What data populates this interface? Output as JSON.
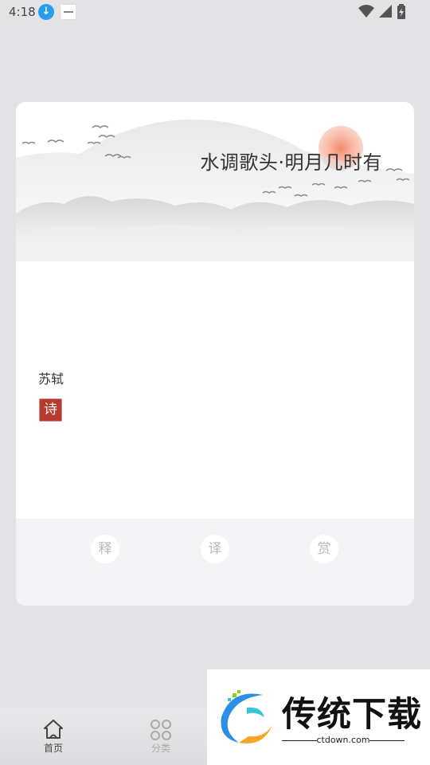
{
  "status_bar": {
    "time": "4:18",
    "download_icon": "download-icon",
    "app_thumbnail_icon": "app-thumbnail-icon",
    "wifi_icon": "wifi-icon",
    "signal_icon": "signal-icon",
    "battery_icon": "battery-charging-icon"
  },
  "poem": {
    "title": "水调歌头·明月几时有",
    "author": "苏轼",
    "seal_char": "诗"
  },
  "actions": {
    "explain": "释",
    "translate": "译",
    "appreciate": "赏"
  },
  "nav": {
    "items": [
      {
        "label": "首页",
        "icon": "home-icon",
        "active": true
      },
      {
        "label": "分类",
        "icon": "grid-icon",
        "active": false
      }
    ]
  },
  "watermark": {
    "title": "传统下载",
    "site": "ctdown.com"
  },
  "colors": {
    "background": "#e3e3e5",
    "card": "#ffffff",
    "footer": "#f4f4f6",
    "seal": "#b73a2e",
    "sun": "#f0775a",
    "nav_active": "#444444",
    "nav_inactive": "#aaaaaa"
  }
}
